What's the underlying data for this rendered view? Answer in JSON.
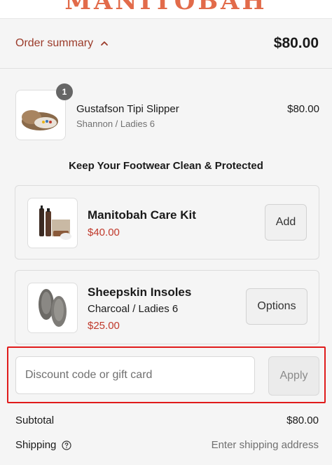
{
  "brand": {
    "name": "MANITOBAH",
    "color": "#e26b4a"
  },
  "summary": {
    "toggle_label": "Order summary",
    "toggle_icon": "chevron-up-icon",
    "total": "$80.00",
    "accent": "#9b3b2a"
  },
  "line_item": {
    "quantity": "1",
    "name": "Gustafson Tipi Slipper",
    "variant": "Shannon / Ladies 6",
    "price": "$80.00"
  },
  "upsell": {
    "heading": "Keep Your Footwear Clean & Protected",
    "items": [
      {
        "title": "Manitobah Care Kit",
        "price": "$40.00",
        "button": "Add"
      },
      {
        "title": "Sheepskin Insoles",
        "variant": "Charcoal / Ladies 6",
        "price": "$25.00",
        "button": "Options"
      }
    ]
  },
  "discount": {
    "placeholder": "Discount code or gift card",
    "value": "",
    "apply_label": "Apply",
    "highlight_color": "#e01b1b"
  },
  "totals": {
    "subtotal_label": "Subtotal",
    "subtotal_value": "$80.00",
    "shipping_label": "Shipping",
    "shipping_icon": "help-circle-icon",
    "shipping_value": "Enter shipping address"
  }
}
